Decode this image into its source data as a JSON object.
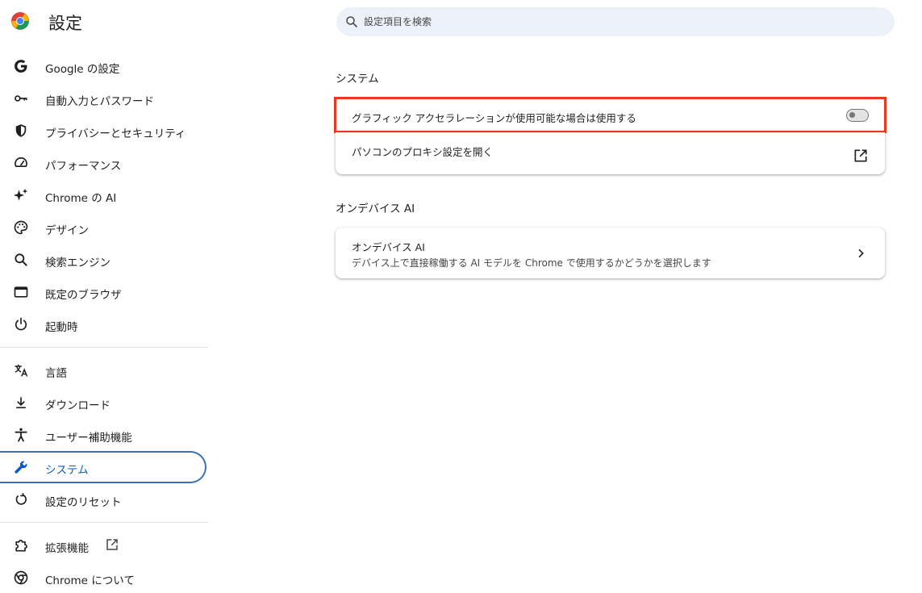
{
  "header": {
    "title": "設定",
    "search_placeholder": "設定項目を検索"
  },
  "sidebar": {
    "items": [
      {
        "label": "Google の設定",
        "icon": "google-g-icon"
      },
      {
        "label": "自動入力とパスワード",
        "icon": "key-icon"
      },
      {
        "label": "プライバシーとセキュリティ",
        "icon": "shield-icon"
      },
      {
        "label": "パフォーマンス",
        "icon": "speedometer-icon"
      },
      {
        "label": "Chrome の AI",
        "icon": "sparkle-icon"
      },
      {
        "label": "デザイン",
        "icon": "palette-icon"
      },
      {
        "label": "検索エンジン",
        "icon": "search-icon"
      },
      {
        "label": "既定のブラウザ",
        "icon": "browser-window-icon"
      },
      {
        "label": "起動時",
        "icon": "power-icon"
      },
      {
        "label": "言語",
        "icon": "translate-icon"
      },
      {
        "label": "ダウンロード",
        "icon": "download-icon"
      },
      {
        "label": "ユーザー補助機能",
        "icon": "accessibility-icon"
      },
      {
        "label": "システム",
        "icon": "wrench-icon",
        "active": true
      },
      {
        "label": "設定のリセット",
        "icon": "reset-icon"
      },
      {
        "label": "拡張機能",
        "icon": "puzzle-icon"
      },
      {
        "label": "Chrome について",
        "icon": "chrome-icon"
      }
    ]
  },
  "main": {
    "system_section": {
      "title": "システム",
      "rows": [
        {
          "label": "グラフィック アクセラレーションが使用可能な場合は使用する",
          "toggle_on": false
        },
        {
          "label": "パソコンのプロキシ設定を開く"
        }
      ]
    },
    "ondevice_section": {
      "title": "オンデバイス AI",
      "rows": [
        {
          "label": "オンデバイス AI",
          "sublabel": "デバイス上で直接稼働する AI モデルを Chrome で使用するかどうかを選択します"
        }
      ]
    }
  },
  "colors": {
    "accent": "#0b57d0",
    "active_border": "#3e6fb5",
    "highlight_red": "#e8391b",
    "search_bg": "#edf2fa"
  }
}
